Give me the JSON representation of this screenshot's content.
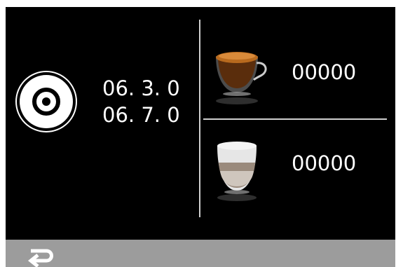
{
  "display": {
    "versions": [
      "06. 3. 0",
      "06. 7. 0"
    ],
    "counters": [
      {
        "icon": "espresso-cup-icon",
        "value": "00000"
      },
      {
        "icon": "latte-cup-icon",
        "value": "00000"
      }
    ],
    "colors": {
      "background": "#000000",
      "text": "#ffffff",
      "divider": "#cfcfcf",
      "bottom_bar": "#9c9c9c",
      "espresso_crema": "#b86a1e"
    },
    "icons": {
      "disc": "disc-icon",
      "back": "back-arrow-icon"
    }
  }
}
